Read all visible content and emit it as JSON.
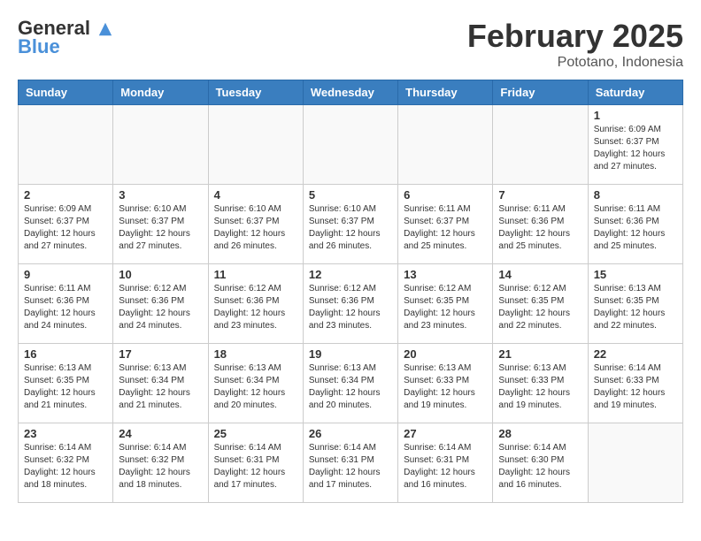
{
  "header": {
    "logo_line1": "General",
    "logo_line2": "Blue",
    "month": "February 2025",
    "location": "Pototano, Indonesia"
  },
  "weekdays": [
    "Sunday",
    "Monday",
    "Tuesday",
    "Wednesday",
    "Thursday",
    "Friday",
    "Saturday"
  ],
  "weeks": [
    [
      {
        "day": "",
        "info": ""
      },
      {
        "day": "",
        "info": ""
      },
      {
        "day": "",
        "info": ""
      },
      {
        "day": "",
        "info": ""
      },
      {
        "day": "",
        "info": ""
      },
      {
        "day": "",
        "info": ""
      },
      {
        "day": "1",
        "info": "Sunrise: 6:09 AM\nSunset: 6:37 PM\nDaylight: 12 hours\nand 27 minutes."
      }
    ],
    [
      {
        "day": "2",
        "info": "Sunrise: 6:09 AM\nSunset: 6:37 PM\nDaylight: 12 hours\nand 27 minutes."
      },
      {
        "day": "3",
        "info": "Sunrise: 6:10 AM\nSunset: 6:37 PM\nDaylight: 12 hours\nand 27 minutes."
      },
      {
        "day": "4",
        "info": "Sunrise: 6:10 AM\nSunset: 6:37 PM\nDaylight: 12 hours\nand 26 minutes."
      },
      {
        "day": "5",
        "info": "Sunrise: 6:10 AM\nSunset: 6:37 PM\nDaylight: 12 hours\nand 26 minutes."
      },
      {
        "day": "6",
        "info": "Sunrise: 6:11 AM\nSunset: 6:37 PM\nDaylight: 12 hours\nand 25 minutes."
      },
      {
        "day": "7",
        "info": "Sunrise: 6:11 AM\nSunset: 6:36 PM\nDaylight: 12 hours\nand 25 minutes."
      },
      {
        "day": "8",
        "info": "Sunrise: 6:11 AM\nSunset: 6:36 PM\nDaylight: 12 hours\nand 25 minutes."
      }
    ],
    [
      {
        "day": "9",
        "info": "Sunrise: 6:11 AM\nSunset: 6:36 PM\nDaylight: 12 hours\nand 24 minutes."
      },
      {
        "day": "10",
        "info": "Sunrise: 6:12 AM\nSunset: 6:36 PM\nDaylight: 12 hours\nand 24 minutes."
      },
      {
        "day": "11",
        "info": "Sunrise: 6:12 AM\nSunset: 6:36 PM\nDaylight: 12 hours\nand 23 minutes."
      },
      {
        "day": "12",
        "info": "Sunrise: 6:12 AM\nSunset: 6:36 PM\nDaylight: 12 hours\nand 23 minutes."
      },
      {
        "day": "13",
        "info": "Sunrise: 6:12 AM\nSunset: 6:35 PM\nDaylight: 12 hours\nand 23 minutes."
      },
      {
        "day": "14",
        "info": "Sunrise: 6:12 AM\nSunset: 6:35 PM\nDaylight: 12 hours\nand 22 minutes."
      },
      {
        "day": "15",
        "info": "Sunrise: 6:13 AM\nSunset: 6:35 PM\nDaylight: 12 hours\nand 22 minutes."
      }
    ],
    [
      {
        "day": "16",
        "info": "Sunrise: 6:13 AM\nSunset: 6:35 PM\nDaylight: 12 hours\nand 21 minutes."
      },
      {
        "day": "17",
        "info": "Sunrise: 6:13 AM\nSunset: 6:34 PM\nDaylight: 12 hours\nand 21 minutes."
      },
      {
        "day": "18",
        "info": "Sunrise: 6:13 AM\nSunset: 6:34 PM\nDaylight: 12 hours\nand 20 minutes."
      },
      {
        "day": "19",
        "info": "Sunrise: 6:13 AM\nSunset: 6:34 PM\nDaylight: 12 hours\nand 20 minutes."
      },
      {
        "day": "20",
        "info": "Sunrise: 6:13 AM\nSunset: 6:33 PM\nDaylight: 12 hours\nand 19 minutes."
      },
      {
        "day": "21",
        "info": "Sunrise: 6:13 AM\nSunset: 6:33 PM\nDaylight: 12 hours\nand 19 minutes."
      },
      {
        "day": "22",
        "info": "Sunrise: 6:14 AM\nSunset: 6:33 PM\nDaylight: 12 hours\nand 19 minutes."
      }
    ],
    [
      {
        "day": "23",
        "info": "Sunrise: 6:14 AM\nSunset: 6:32 PM\nDaylight: 12 hours\nand 18 minutes."
      },
      {
        "day": "24",
        "info": "Sunrise: 6:14 AM\nSunset: 6:32 PM\nDaylight: 12 hours\nand 18 minutes."
      },
      {
        "day": "25",
        "info": "Sunrise: 6:14 AM\nSunset: 6:31 PM\nDaylight: 12 hours\nand 17 minutes."
      },
      {
        "day": "26",
        "info": "Sunrise: 6:14 AM\nSunset: 6:31 PM\nDaylight: 12 hours\nand 17 minutes."
      },
      {
        "day": "27",
        "info": "Sunrise: 6:14 AM\nSunset: 6:31 PM\nDaylight: 12 hours\nand 16 minutes."
      },
      {
        "day": "28",
        "info": "Sunrise: 6:14 AM\nSunset: 6:30 PM\nDaylight: 12 hours\nand 16 minutes."
      },
      {
        "day": "",
        "info": ""
      }
    ]
  ]
}
